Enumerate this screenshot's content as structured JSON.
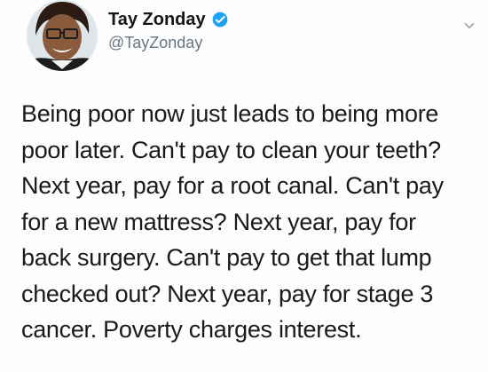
{
  "tweet": {
    "author": {
      "display_name": "Tay Zonday",
      "handle": "@TayZonday",
      "verified": true,
      "avatar_icon": "avatar"
    },
    "text": "Being poor now just leads to being more\npoor later. Can't pay to clean your teeth?\nNext year, pay for a root canal. Can't pay\nfor a new mattress? Next year, pay for\nback surgery. Can't pay to get that lump\nchecked out? Next year, pay for stage 3\ncancer. Poverty charges interest.",
    "menu_icon": "chevron-down-icon",
    "colors": {
      "verified_badge": "#1da1f2",
      "handle": "#657786",
      "text": "#1a1a1a"
    }
  }
}
